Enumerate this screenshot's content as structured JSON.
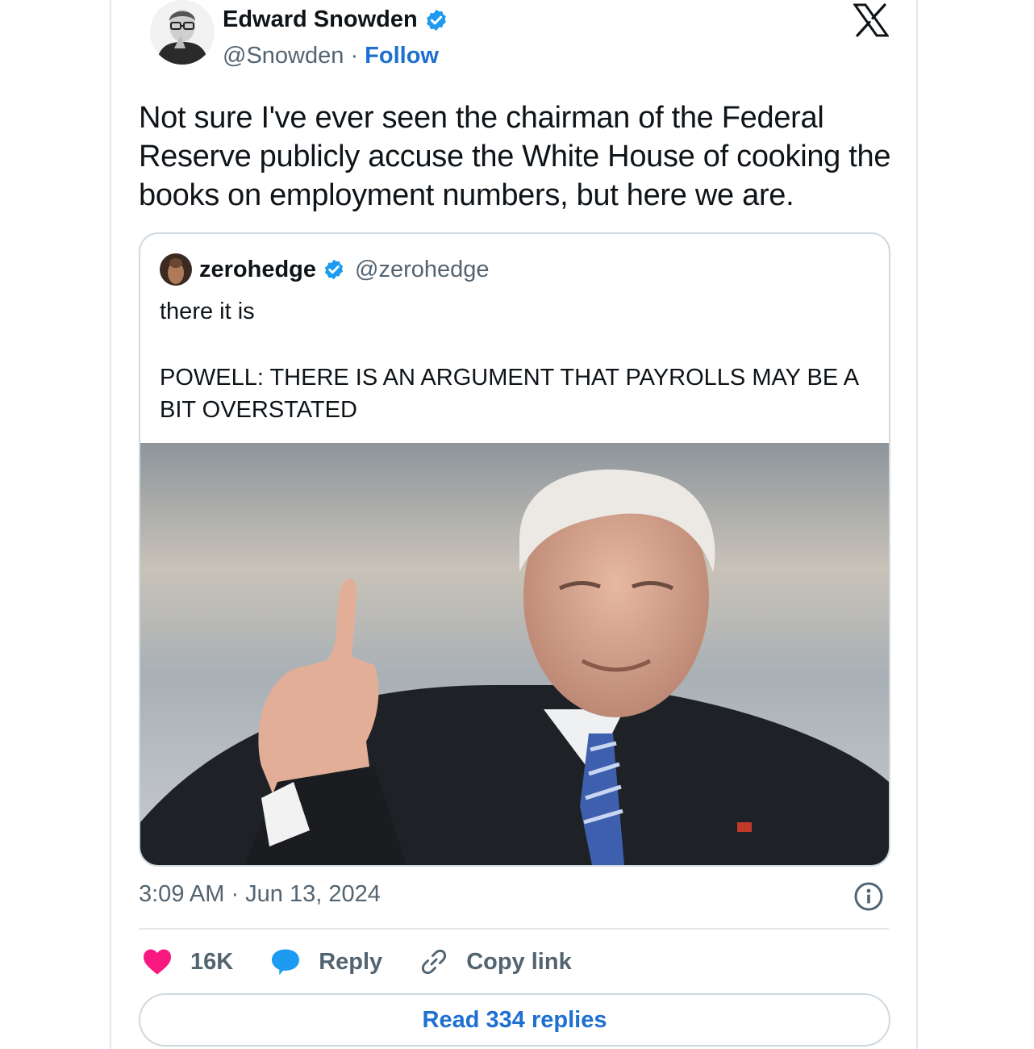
{
  "author": {
    "name": "Edward Snowden",
    "handle": "@Snowden",
    "separator": "·",
    "follow_label": "Follow",
    "verified_icon": "verified-badge-icon",
    "avatar_icon": "user-avatar"
  },
  "platform": {
    "logo": "x-logo-icon"
  },
  "tweet": {
    "text": "Not sure I've ever seen the chairman of the Federal Reserve publicly accuse the White House of cooking the books on employment numbers, but here we are."
  },
  "quoted": {
    "name": "zerohedge",
    "handle": "@zerohedge",
    "text_line1": "there it is",
    "text_line2": "POWELL: THERE IS AN ARGUMENT THAT PAYROLLS MAY BE A BIT OVERSTATED",
    "photo": "photo-of-man-giving-thumbs-up"
  },
  "meta": {
    "timestamp": "3:09 AM · Jun 13, 2024"
  },
  "actions": {
    "likes_count": "16K",
    "reply_label": "Reply",
    "copy_link_label": "Copy link"
  },
  "footer": {
    "read_replies_label": "Read 334 replies"
  },
  "colors": {
    "accent": "#1d6fd1",
    "verified": "#1d9bf0",
    "like": "#f91880",
    "muted": "#536471",
    "border": "#cfd9de"
  }
}
